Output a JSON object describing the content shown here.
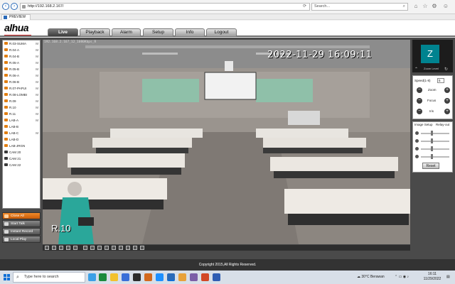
{
  "browser": {
    "url": "http://192.168.2.167/",
    "search_placeholder": "Search...",
    "tab_title": "PREVIEW"
  },
  "app": {
    "logo": "alhua",
    "menu": [
      "Live",
      "Playback",
      "Alarm",
      "Setup",
      "Info",
      "Logout"
    ],
    "active_menu": "Live"
  },
  "cameras": [
    {
      "label": "R.03-SUMA",
      "m": "M"
    },
    {
      "label": "R.04-A",
      "m": "M"
    },
    {
      "label": "R.04-B",
      "m": "M"
    },
    {
      "label": "R.05-A",
      "m": "M"
    },
    {
      "label": "R.05-B",
      "m": "M"
    },
    {
      "label": "R.06-A",
      "m": "M"
    },
    {
      "label": "R.06-B",
      "m": "M"
    },
    {
      "label": "R.07-PAPUI",
      "m": "M"
    },
    {
      "label": "R.08-LOMBI",
      "m": "M"
    },
    {
      "label": "R.09",
      "m": "M"
    },
    {
      "label": "R.10",
      "m": "M"
    },
    {
      "label": "R.11",
      "m": "M"
    },
    {
      "label": "LAB-A",
      "m": "M"
    },
    {
      "label": "LAB-B",
      "m": ""
    },
    {
      "label": "LAB-C",
      "m": "M"
    },
    {
      "label": "LAB-D",
      "m": ""
    },
    {
      "label": "LAB-JRGN",
      "m": ""
    },
    {
      "label": "CAM 20",
      "m": ""
    },
    {
      "label": "CAM 21",
      "m": ""
    },
    {
      "label": "CAM 22",
      "m": ""
    }
  ],
  "left_buttons": {
    "close_all": "Close All",
    "start_talk": "Start Talk",
    "instant_record": "Instant Record",
    "local_play": "Local Play"
  },
  "video": {
    "stream_info": "192.168.2.167_12_1080Kbps_R",
    "timestamp": "2022-11-29 16:09:11",
    "camera_name": "R.10"
  },
  "avatar": {
    "initial": "Z",
    "label": "Zoom Level"
  },
  "ptz": {
    "speed_label": "Speed(1-8)",
    "speed_value": "5",
    "zoom": "Zoom",
    "focus": "Focus",
    "iris": "Iris"
  },
  "image_setup": {
    "title": "Image Setup",
    "relay": "Relay-out",
    "reset": "Reset",
    "sliders": [
      {
        "name": "brightness",
        "level": 0.35
      },
      {
        "name": "contrast",
        "level": 0.35
      },
      {
        "name": "saturation",
        "level": 0.35
      },
      {
        "name": "hue",
        "level": 0.35
      }
    ]
  },
  "footer": {
    "copyright": "Copyright 2015,All Rights Reserved."
  },
  "taskbar": {
    "search_placeholder": "Type here to search",
    "weather": "30°C  Berawan",
    "time": "16:11",
    "date": "11/29/2022"
  }
}
